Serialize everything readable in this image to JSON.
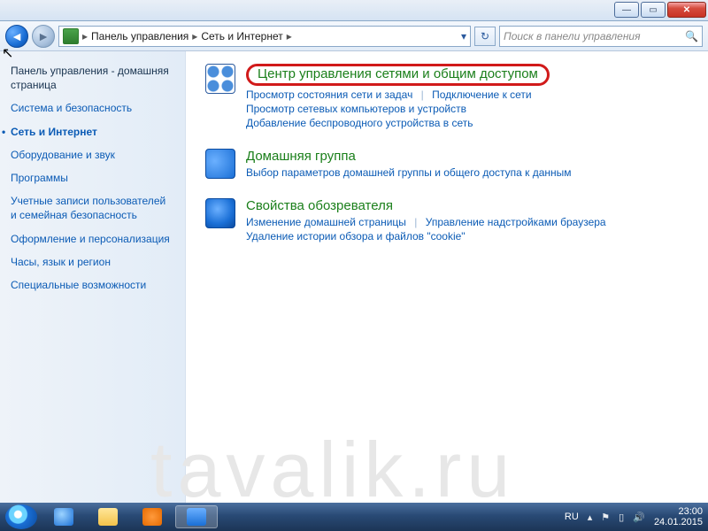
{
  "window_buttons": {
    "min": "—",
    "max": "▭",
    "close": "✕"
  },
  "breadcrumb": {
    "root": "Панель управления",
    "level1": "Сеть и Интернет"
  },
  "search": {
    "placeholder": "Поиск в панели управления"
  },
  "sidebar": {
    "home": "Панель управления - домашняя страница",
    "items": [
      "Система и безопасность",
      "Сеть и Интернет",
      "Оборудование и звук",
      "Программы",
      "Учетные записи пользователей и семейная безопасность",
      "Оформление и персонализация",
      "Часы, язык и регион",
      "Специальные возможности"
    ],
    "active_index": 1
  },
  "sections": [
    {
      "title": "Центр управления сетями и общим доступом",
      "highlighted": true,
      "links_rows": [
        [
          "Просмотр состояния сети и задач",
          "Подключение к сети"
        ],
        [
          "Просмотр сетевых компьютеров и устройств"
        ],
        [
          "Добавление беспроводного устройства в сеть"
        ]
      ]
    },
    {
      "title": "Домашняя группа",
      "highlighted": false,
      "links_rows": [
        [
          "Выбор параметров домашней группы и общего доступа к данным"
        ]
      ]
    },
    {
      "title": "Свойства обозревателя",
      "highlighted": false,
      "links_rows": [
        [
          "Изменение домашней страницы",
          "Управление надстройками браузера"
        ],
        [
          "Удаление истории обзора и файлов \"cookie\""
        ]
      ]
    }
  ],
  "watermark": "tavalik.ru",
  "tray": {
    "lang": "RU",
    "time": "23:00",
    "date": "24.01.2015"
  }
}
